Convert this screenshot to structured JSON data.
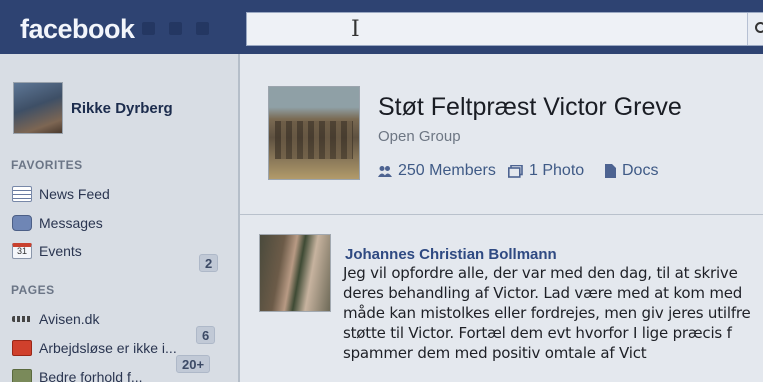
{
  "header": {
    "logo": "facebook",
    "icons": [
      "friend-requests-icon",
      "messages-icon",
      "notifications-icon",
      "search-icon"
    ]
  },
  "user": {
    "name": "Rikke Dyrberg"
  },
  "sidebar": {
    "favorites_title": "FAVORITES",
    "favorites": [
      {
        "label": "News Feed",
        "icon": "news-feed-icon"
      },
      {
        "label": "Messages",
        "icon": "messages-icon"
      },
      {
        "label": "Events",
        "icon": "events-icon",
        "icon_text": "31",
        "count": "2"
      }
    ],
    "pages_title": "PAGES",
    "pages": [
      {
        "label": "Avisen.dk",
        "icon": "page-icon",
        "count": "6"
      },
      {
        "label": "Arbejdsløse er ikke i...",
        "icon": "page-icon",
        "count": "20+"
      },
      {
        "label": "Bedre forhold f...",
        "icon": "page-icon"
      }
    ]
  },
  "group": {
    "title": "Støt Feltpræst Victor Greve",
    "type": "Open Group",
    "members": "250 Members",
    "photos": "1 Photo",
    "docs": "Docs"
  },
  "post": {
    "author": "Johannes Christian Bollmann",
    "lines": [
      "Jeg vil opfordre alle, der var med den dag, til at skrive",
      "deres behandling af Victor. Lad være med at kom med",
      "måde kan mistolkes eller fordrejes, men giv jeres utilfre",
      "støtte til Victor. Fortæl dem evt hvorfor I lige præcis f",
      "spammer dem med positiv omtale af Vict"
    ]
  },
  "colors": {
    "topbar": "#2e4372",
    "link": "#2f4a82",
    "background": "#e4e8ee"
  }
}
